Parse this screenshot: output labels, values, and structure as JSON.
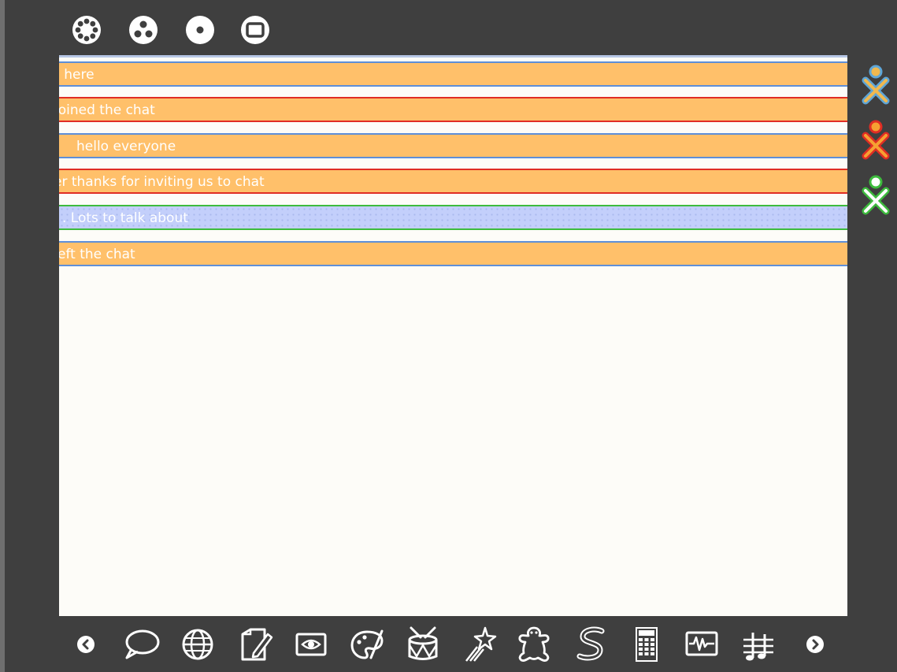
{
  "zoom_toolbar": {
    "items": [
      {
        "name": "neighborhood-view",
        "icon": "neighborhood-icon"
      },
      {
        "name": "group-view",
        "icon": "group-icon"
      },
      {
        "name": "home-view",
        "icon": "home-icon"
      },
      {
        "name": "activity-view",
        "icon": "activity-icon"
      }
    ]
  },
  "chat": {
    "messages": [
      {
        "text": "s here",
        "style": "orange",
        "border": "blue"
      },
      {
        "text": "joined the chat",
        "style": "orange",
        "border": "red"
      },
      {
        "text": "hello everyone",
        "style": "orange",
        "border": "blue"
      },
      {
        "text": "er   thanks for inviting us to chat",
        "style": "orange",
        "border": "red"
      },
      {
        "text": ". Lots to talk about",
        "style": "lightblue",
        "border": "green"
      },
      {
        "text": "eft the chat",
        "style": "orange",
        "border": "blue"
      }
    ]
  },
  "buddies": [
    {
      "name": "buddy-blue",
      "stroke": "#5ea6d8",
      "fill": "#f0b84f"
    },
    {
      "name": "buddy-red",
      "stroke": "#e02d24",
      "fill": "#f6a032"
    },
    {
      "name": "buddy-green",
      "stroke": "#3dbb3d",
      "fill": "#ffffff"
    }
  ],
  "activity_frame": {
    "items": [
      "scroll-left-icon",
      "chat-icon",
      "browse-icon",
      "write-icon",
      "record-icon",
      "paint-icon",
      "tamtam-icon",
      "turtle-art-icon",
      "etoys-icon",
      "speak-icon",
      "calculate-icon",
      "measure-icon",
      "tamtam-edit-icon",
      "scroll-right-icon"
    ]
  },
  "colors": {
    "background": "#3f3f3f",
    "panel": "#fdfcf8",
    "message_orange": "#ffc06a",
    "message_lightblue": "#c3cffb",
    "border_blue": "#5e8fd8",
    "border_red": "#e02d24",
    "border_green": "#3dbb3d"
  }
}
